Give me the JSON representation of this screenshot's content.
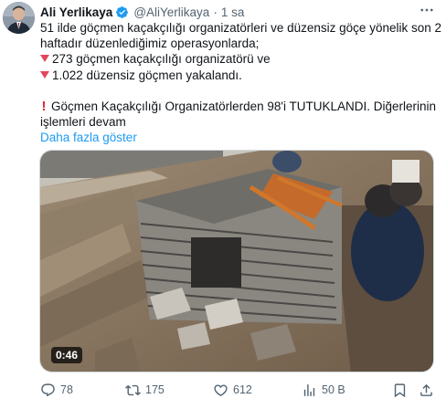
{
  "author": {
    "name": "Ali Yerlikaya",
    "handle": "@AliYerlikaya",
    "separator": "·",
    "time": "1 sa"
  },
  "tweet": {
    "line1": "51 ilde göçmen kaçakçılığı organizatörleri ve düzensiz göçe yönelik son 2",
    "line2": "haftadır düzenlediğimiz operasyonlarda;",
    "bullet1": "273 göçmen kaçakçılığı organizatörü ve",
    "bullet2": "1.022 düzensiz göçmen yakalandı.",
    "line5": "Göçmen Kaçakçılığı Organizatörlerden 98'i TUTUKLANDI. Diğerlerinin",
    "line6": "işlemleri devam",
    "show_more": "Daha fazla göster"
  },
  "media": {
    "duration": "0:46"
  },
  "actions": {
    "replies": "78",
    "retweets": "175",
    "likes": "612",
    "views": "50 B"
  },
  "colors": {
    "accent": "#1d9bf0",
    "muted": "#536471",
    "bullet_red": "#e0475b"
  },
  "icons": [
    "verified-badge-icon",
    "more-icon",
    "reply-icon",
    "retweet-icon",
    "like-icon",
    "views-icon",
    "bookmark-icon",
    "share-icon"
  ]
}
